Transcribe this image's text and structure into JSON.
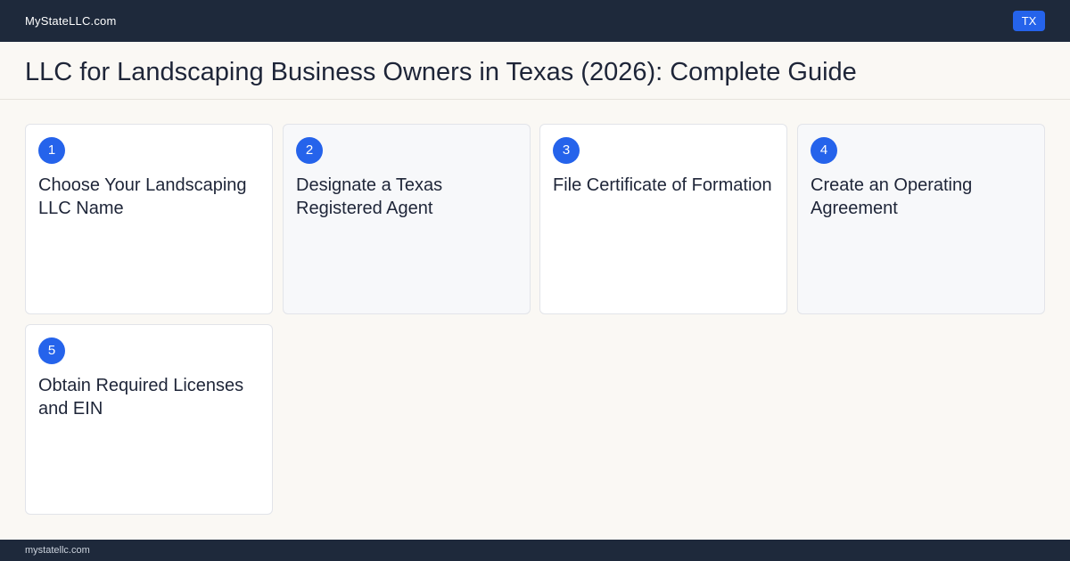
{
  "header": {
    "site_name": "MyStateLLC.com",
    "state_badge": "TX"
  },
  "main": {
    "title": "LLC for Landscaping Business Owners in Texas (2026): Complete Guide",
    "steps": [
      {
        "number": "1",
        "title": "Choose Your Landscaping LLC Name"
      },
      {
        "number": "2",
        "title": "Designate a Texas Registered Agent"
      },
      {
        "number": "3",
        "title": "File Certificate of Formation"
      },
      {
        "number": "4",
        "title": "Create an Operating Agreement"
      },
      {
        "number": "5",
        "title": "Obtain Required Licenses and EIN"
      }
    ]
  },
  "footer": {
    "domain": "mystatellc.com"
  },
  "colors": {
    "header_bg": "#1e293b",
    "accent": "#2563eb",
    "page_bg": "#faf8f4"
  }
}
